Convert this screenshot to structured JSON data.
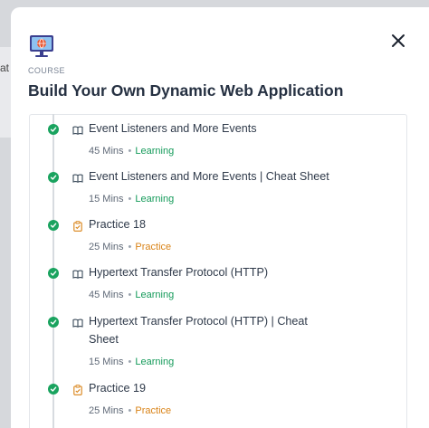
{
  "backdrop": {
    "partial_text": "at"
  },
  "modal": {
    "category": "COURSE",
    "title": "Build Your Own Dynamic Web Application",
    "icons": {
      "course": "monitor-globe-icon",
      "close": "close-icon"
    }
  },
  "items": [
    {
      "title": "Event Listeners and More Events",
      "duration": "45 Mins",
      "separator": "•",
      "tag": "Learning",
      "icon": "book-icon",
      "status": "completed"
    },
    {
      "title": "Event Listeners and More Events | Cheat Sheet",
      "duration": "15 Mins",
      "separator": "•",
      "tag": "Learning",
      "icon": "book-icon",
      "status": "completed"
    },
    {
      "title": "Practice 18",
      "duration": "25 Mins",
      "separator": "•",
      "tag": "Practice",
      "icon": "clipboard-icon",
      "status": "completed"
    },
    {
      "title": "Hypertext Transfer Protocol (HTTP)",
      "duration": "45 Mins",
      "separator": "•",
      "tag": "Learning",
      "icon": "book-icon",
      "status": "completed"
    },
    {
      "title_line1": "Hypertext Transfer Protocol (HTTP) | Cheat",
      "title_line2": "Sheet",
      "duration": "15 Mins",
      "separator": "•",
      "tag": "Learning",
      "icon": "book-icon",
      "status": "completed"
    },
    {
      "title": "Practice 19",
      "duration": "25 Mins",
      "separator": "•",
      "tag": "Practice",
      "icon": "clipboard-icon",
      "status": "completed"
    }
  ],
  "colors": {
    "completed": "#1aa35f",
    "learning": "#139a59",
    "practice": "#d98317",
    "title": "#263142"
  }
}
